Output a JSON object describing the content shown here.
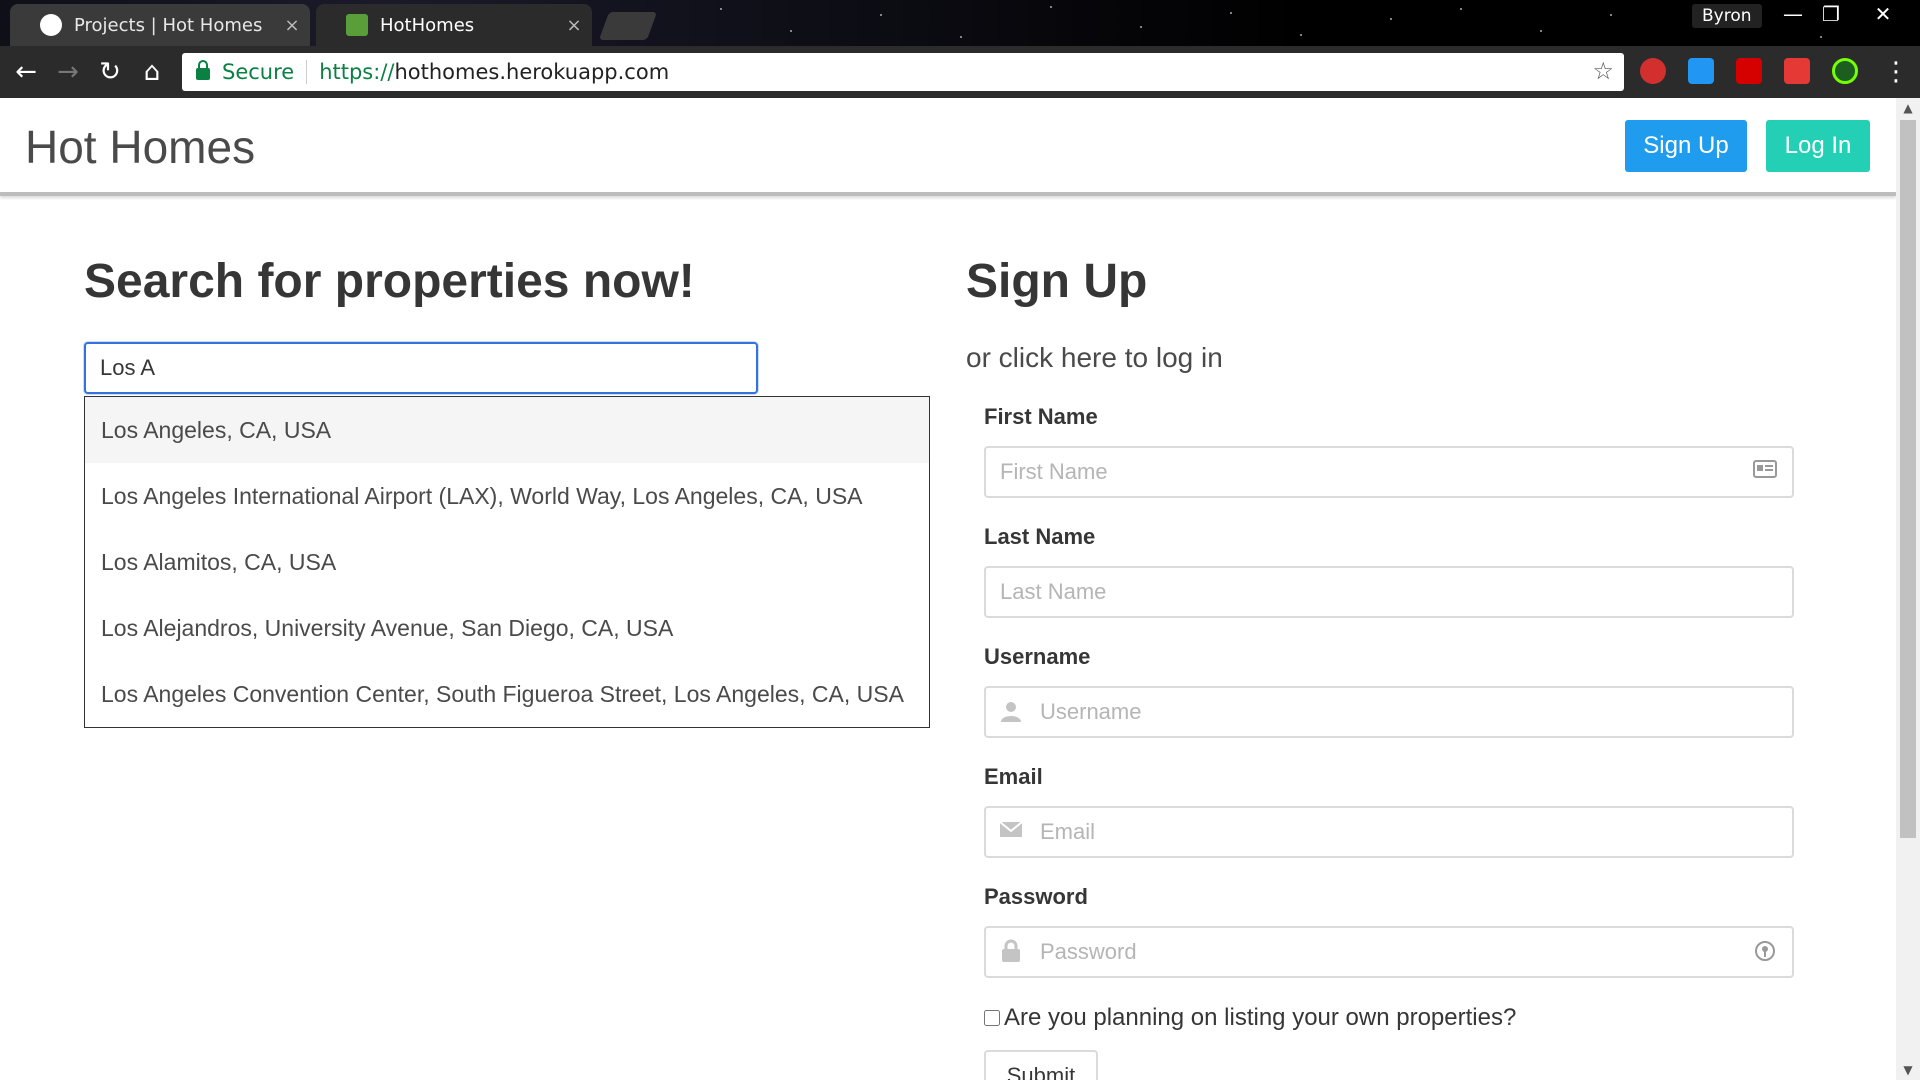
{
  "browser": {
    "tabs": [
      {
        "title": "Projects | Hot Homes",
        "close": "×"
      },
      {
        "title": "HotHomes",
        "close": "×"
      }
    ],
    "profile_name": "Byron",
    "window_controls": {
      "minimize": "—",
      "restore": "❐",
      "close": "✕"
    },
    "nav": {
      "back": "←",
      "forward": "→",
      "reload": "↻",
      "home": "⌂"
    },
    "secure_label": "Secure",
    "url_scheme": "https://",
    "url_host": "hothomes.herokuapp.com",
    "bookmark": "☆",
    "extension_icons": [
      "opera-icon",
      "window-icon",
      "lastpass-icon",
      "plus-icon",
      "target-icon"
    ],
    "menu": "⋮"
  },
  "navbar": {
    "brand": "Hot Homes",
    "signup_label": "Sign Up",
    "login_label": "Log In"
  },
  "search": {
    "title": "Search for properties now!",
    "input_value": "Los A",
    "suggestions": [
      "Los Angeles, CA, USA",
      "Los Angeles International Airport (LAX), World Way, Los Angeles, CA, USA",
      "Los Alamitos, CA, USA",
      "Los Alejandros, University Avenue, San Diego, CA, USA",
      "Los Angeles Convention Center, South Figueroa Street, Los Angeles, CA, USA"
    ]
  },
  "signup": {
    "title": "Sign Up",
    "login_link": "or click here to log in",
    "fields": {
      "first_name": {
        "label": "First Name",
        "placeholder": "First Name"
      },
      "last_name": {
        "label": "Last Name",
        "placeholder": "Last Name"
      },
      "username": {
        "label": "Username",
        "placeholder": "Username"
      },
      "email": {
        "label": "Email",
        "placeholder": "Email"
      },
      "password": {
        "label": "Password",
        "placeholder": "Password"
      }
    },
    "checkbox_label": "Are you planning on listing your own properties?",
    "submit_label": "Submit"
  },
  "colors": {
    "primary": "#209cee",
    "turquoise": "#23d0b5",
    "link_focus": "#3273dc"
  }
}
